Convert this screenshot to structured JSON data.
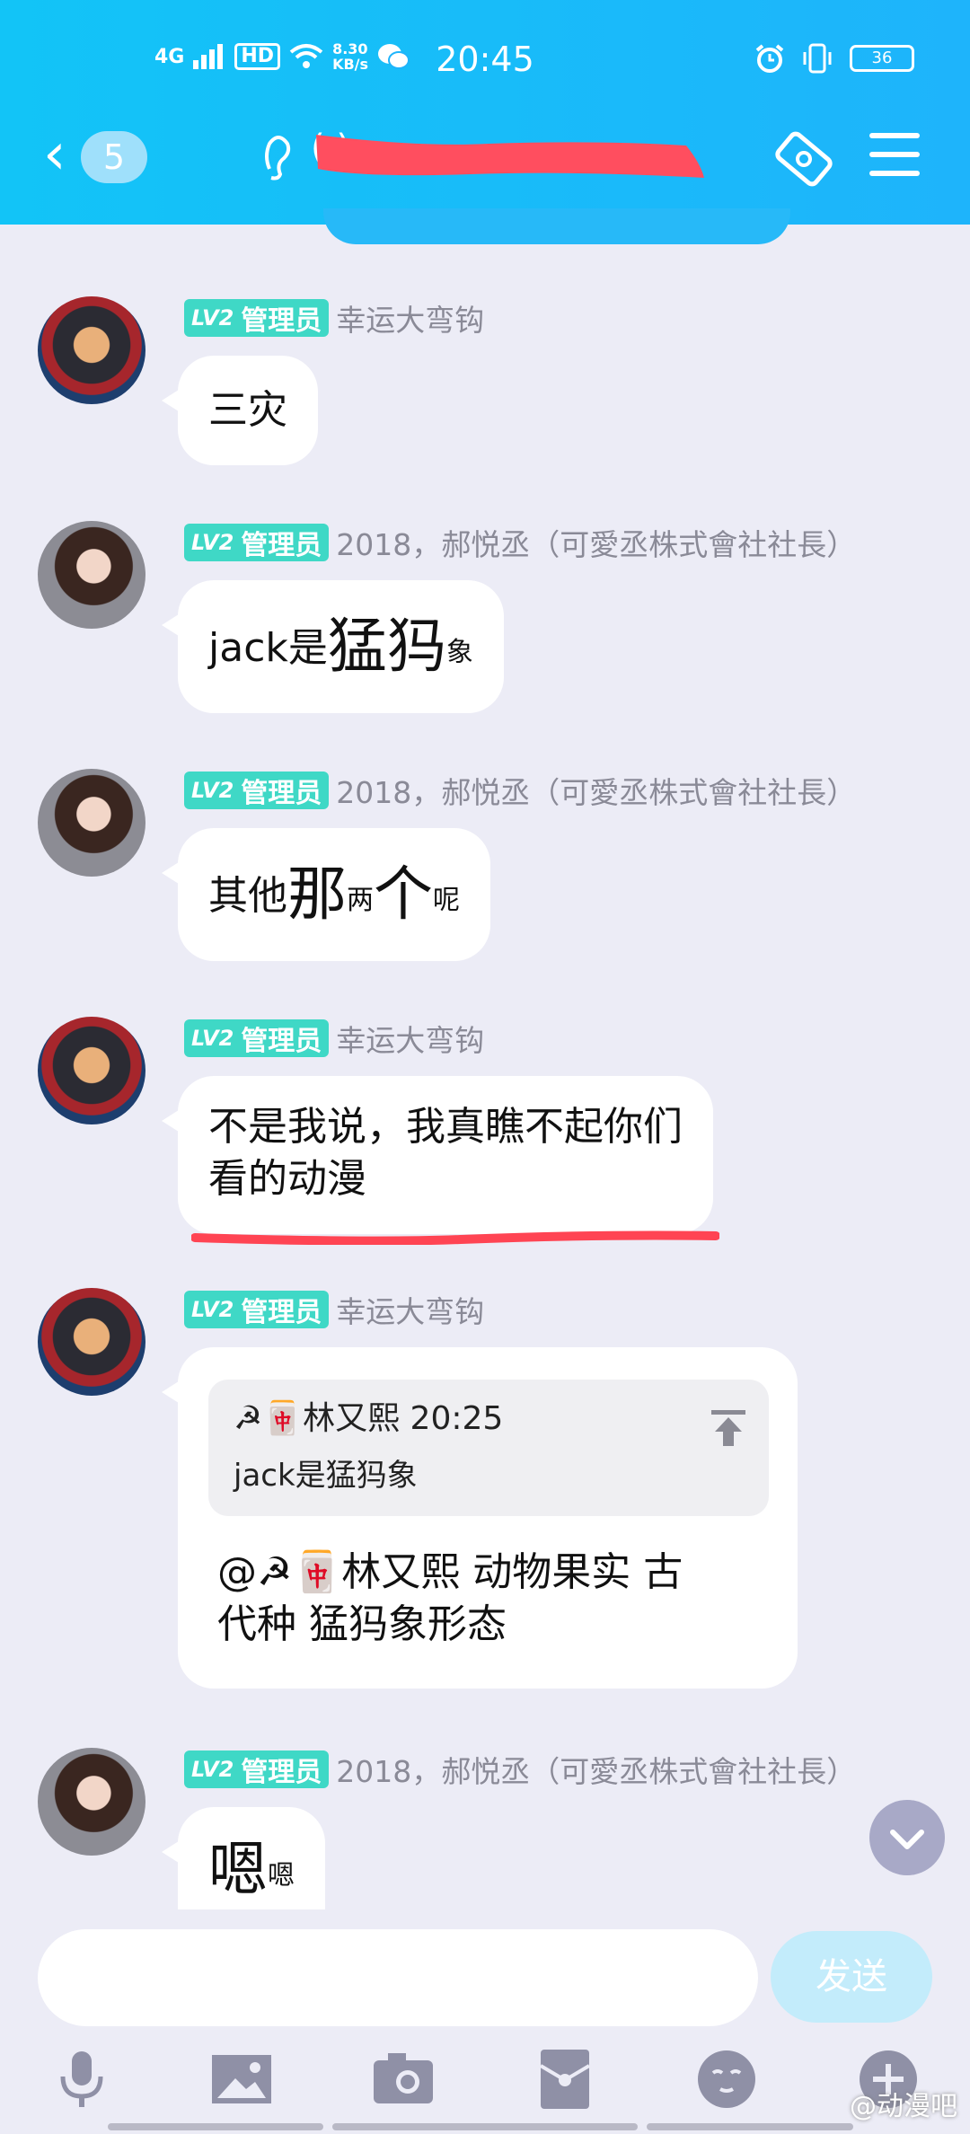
{
  "status_bar": {
    "network": "4G",
    "hd": "HD",
    "speed_value": "8.30",
    "speed_unit": "KB/s",
    "time": "20:45",
    "battery": "36"
  },
  "nav": {
    "back_count": "5",
    "title": "( )"
  },
  "messages": [
    {
      "level": "LV2",
      "role": "管理员",
      "sender": "幸运大弯钩",
      "text": "三灾"
    },
    {
      "level": "LV2",
      "role": "管理员",
      "sender": "2018，郝悦丞（可愛丞株式會社社長）",
      "text_a": "jack是",
      "text_b": "猛犸",
      "text_c": "象"
    },
    {
      "level": "LV2",
      "role": "管理员",
      "sender": "2018，郝悦丞（可愛丞株式會社社長）",
      "text_a": "其他",
      "text_b": "那",
      "text_c": "两",
      "text_d": "个",
      "text_e": "呢"
    },
    {
      "level": "LV2",
      "role": "管理员",
      "sender": "幸运大弯钩",
      "line1": "不是我说，我真瞧不起你们",
      "line2": "看的动漫"
    },
    {
      "level": "LV2",
      "role": "管理员",
      "sender": "幸运大弯钩",
      "quote_author": "☭🀄林又熙 20:25",
      "quote_text": "jack是猛犸象",
      "line1": "@☭🀄林又熙 动物果实   古",
      "line2": "代种  猛犸象形态"
    },
    {
      "level": "LV2",
      "role": "管理员",
      "sender": "2018，郝悦丞（可愛丞株式會社社長）",
      "text_a": "嗯",
      "text_b": "嗯"
    }
  ],
  "input": {
    "placeholder": "",
    "send_label": "发送"
  },
  "toolbar": [
    "mic-icon",
    "image-icon",
    "camera-icon",
    "red-packet-icon",
    "emoji-icon",
    "plus-icon"
  ],
  "watermark": "@动漫吧",
  "colors": {
    "header": "#1eb4fb",
    "badge": "#3fd8c6",
    "background": "#ececf6"
  }
}
